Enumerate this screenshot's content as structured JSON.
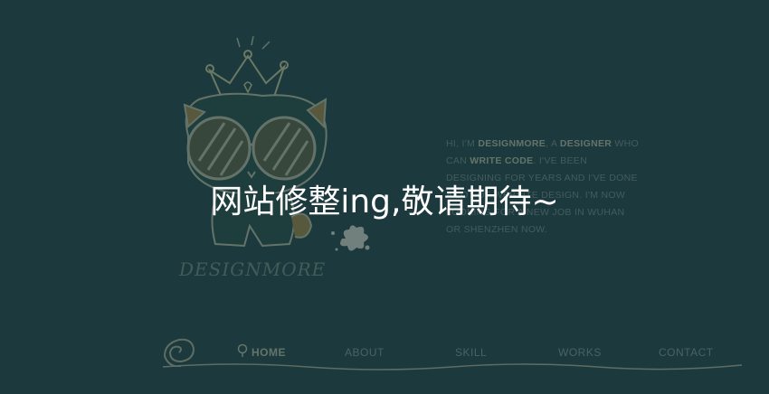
{
  "overlay": {
    "message": "网站修整ing,敬请期待~"
  },
  "brand": {
    "logo_text": "DESIGNMORE"
  },
  "intro": {
    "part1": "Hi, I'm ",
    "name": "DESIGNMORE",
    "part2": ", a ",
    "role": "DESIGNER",
    "part3": " who can ",
    "skill": "WRITE CODE",
    "part4": ". I've been designing for years and I've done a lot of website design. I'm now looking for a new job in Wuhan or Shenzhen now."
  },
  "nav": {
    "items": [
      {
        "label": "HOME",
        "active": true
      },
      {
        "label": "ABOUT",
        "active": false
      },
      {
        "label": "SKILL",
        "active": false
      },
      {
        "label": "WORKS",
        "active": false
      },
      {
        "label": "CONTACT",
        "active": false
      }
    ]
  },
  "colors": {
    "background": "#1c3a3d",
    "overlay_text": "#ffffff",
    "accent": "#c9c3a8",
    "muted": "#7a8b8a"
  }
}
